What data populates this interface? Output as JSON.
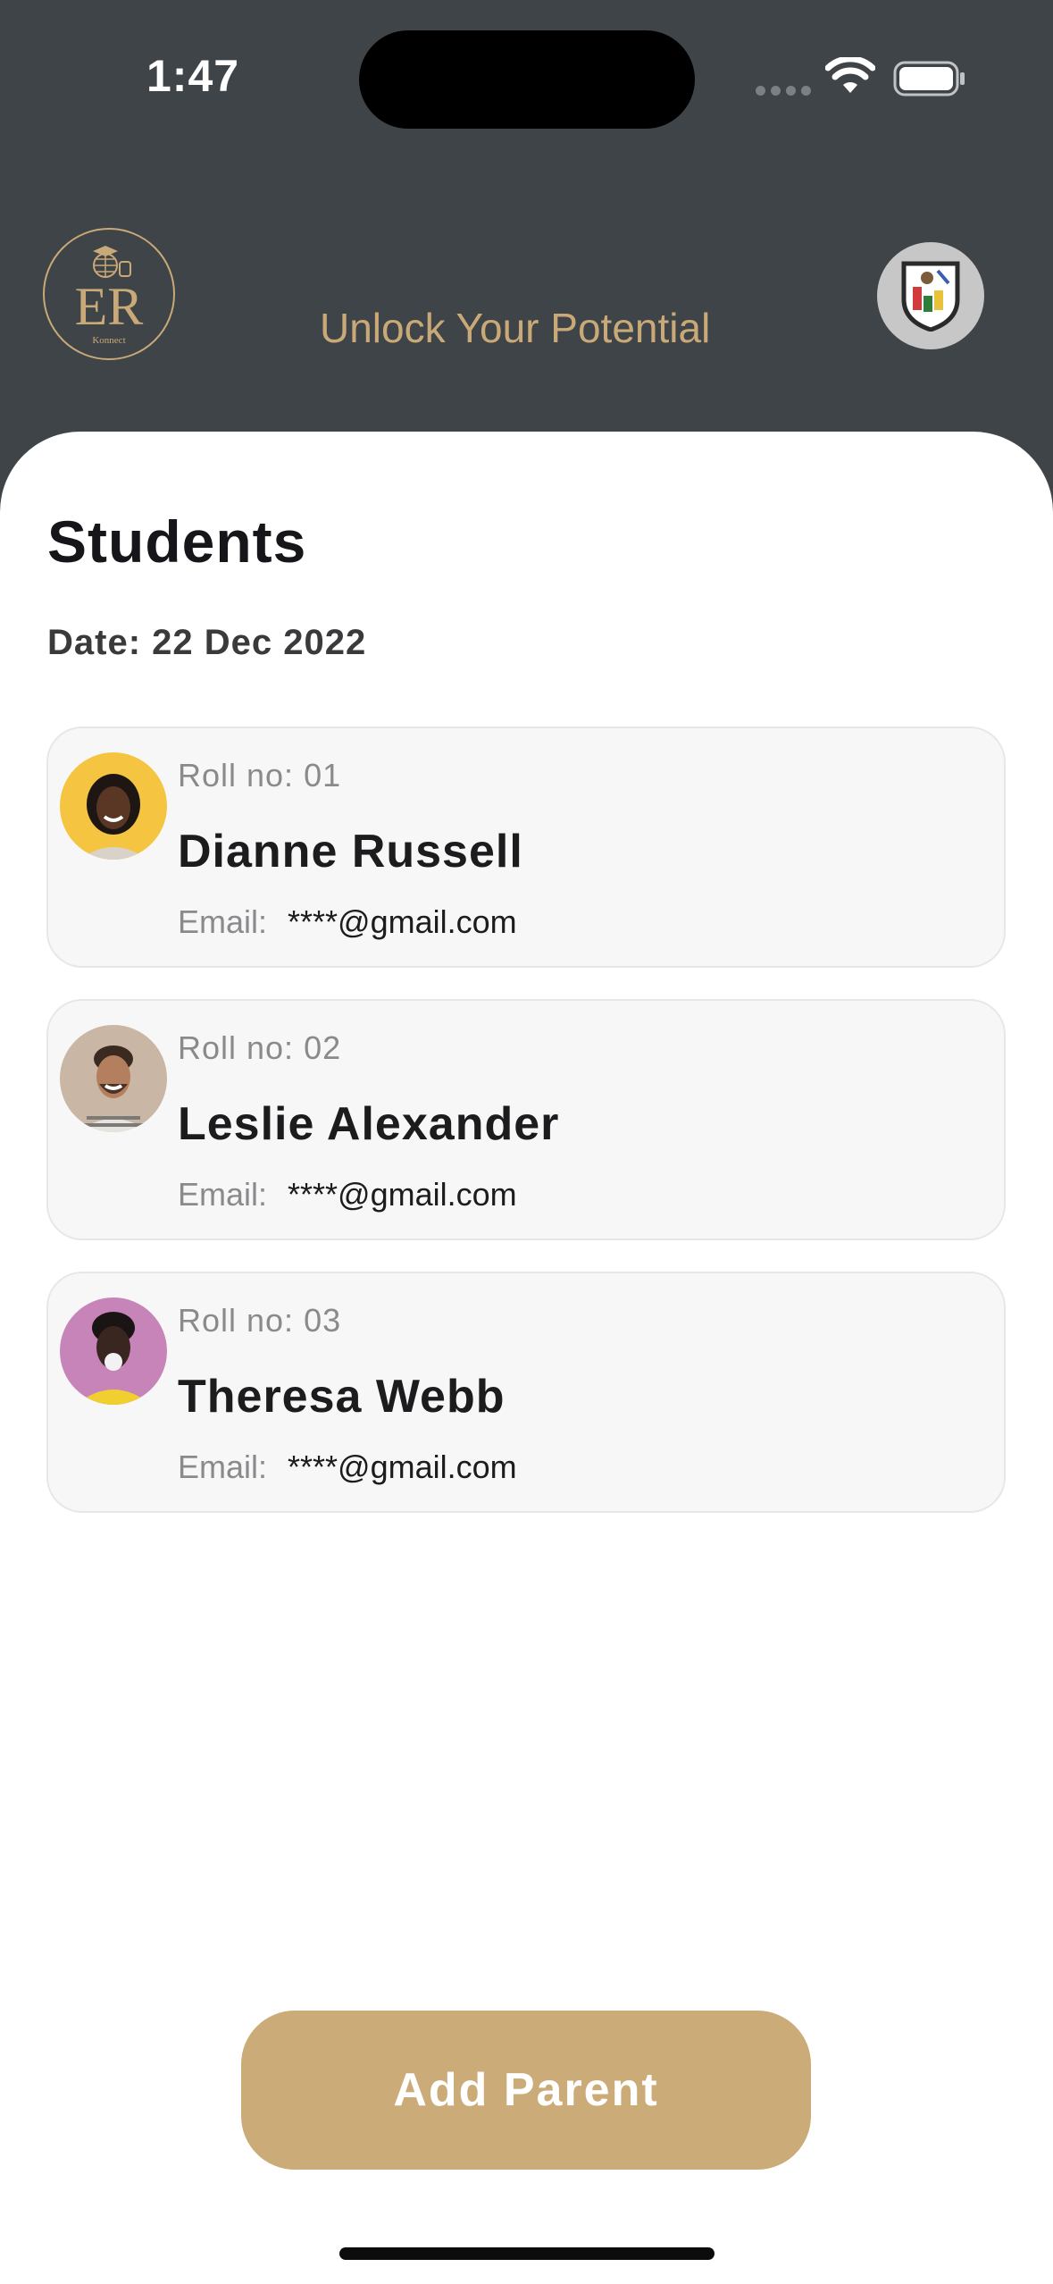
{
  "status_bar": {
    "time": "1:47"
  },
  "header": {
    "logo_text": "ER",
    "logo_subtext": "Konnect",
    "tagline": "Unlock Your Potential"
  },
  "page": {
    "title": "Students",
    "date": "Date: 22 Dec 2022"
  },
  "students": [
    {
      "roll": "Roll no: 01",
      "name": "Dianne Russell",
      "email_label": "Email:",
      "email": "****@gmail.com"
    },
    {
      "roll": "Roll no: 02",
      "name": "Leslie Alexander",
      "email_label": "Email:",
      "email": "****@gmail.com"
    },
    {
      "roll": "Roll no: 03",
      "name": "Theresa Webb",
      "email_label": "Email:",
      "email": "****@gmail.com"
    }
  ],
  "actions": {
    "add_parent": "Add Parent"
  },
  "colors": {
    "header_bg": "#3e4447",
    "accent_gold": "#cbab78",
    "card_bg": "#f7f7f7"
  },
  "icons": [
    "wifi-icon",
    "battery-icon",
    "signal-icon",
    "er-konnect-logo",
    "school-crest-icon"
  ]
}
